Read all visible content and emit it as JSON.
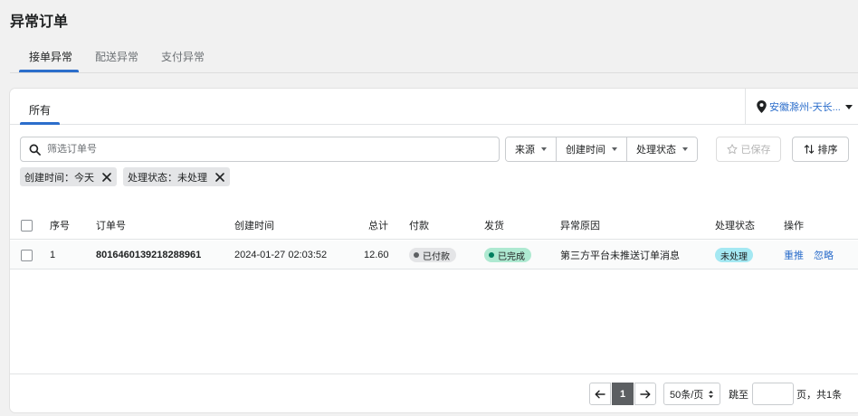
{
  "page": {
    "title": "异常订单"
  },
  "top_tabs": [
    {
      "label": "接单异常",
      "active": true
    },
    {
      "label": "配送异常",
      "active": false
    },
    {
      "label": "支付异常",
      "active": false
    }
  ],
  "card": {
    "tab_label": "所有",
    "location": "安徽滁州-天长..."
  },
  "toolbar": {
    "search_placeholder": "筛选订单号",
    "filters": [
      "来源",
      "创建时间",
      "处理状态"
    ],
    "save_label": "已保存",
    "sort_label": "排序"
  },
  "chips": [
    {
      "label": "创建时间：今天"
    },
    {
      "label": "处理状态：未处理"
    }
  ],
  "table": {
    "headers": [
      "序号",
      "订单号",
      "创建时间",
      "总计",
      "付款",
      "发货",
      "异常原因",
      "处理状态",
      "操作"
    ],
    "rows": [
      {
        "index": "1",
        "order_no": "8016460139218288961",
        "created": "2024-01-27 02:03:52",
        "total": "12.60",
        "payment": "已付款",
        "shipping": "已完成",
        "reason": "第三方平台未推送订单消息",
        "status": "未处理",
        "actions": [
          "重推",
          "忽略"
        ]
      }
    ]
  },
  "pagination": {
    "current": "1",
    "page_size": "50条/页",
    "jump_label": "跳至",
    "jump_value": "",
    "suffix": "页，共1条"
  },
  "colors": {
    "accent": "#2c6ecb",
    "paid_badge": "#e4e5e7",
    "done_badge": "#aee9d1",
    "status_badge": "#a4e8f2"
  }
}
